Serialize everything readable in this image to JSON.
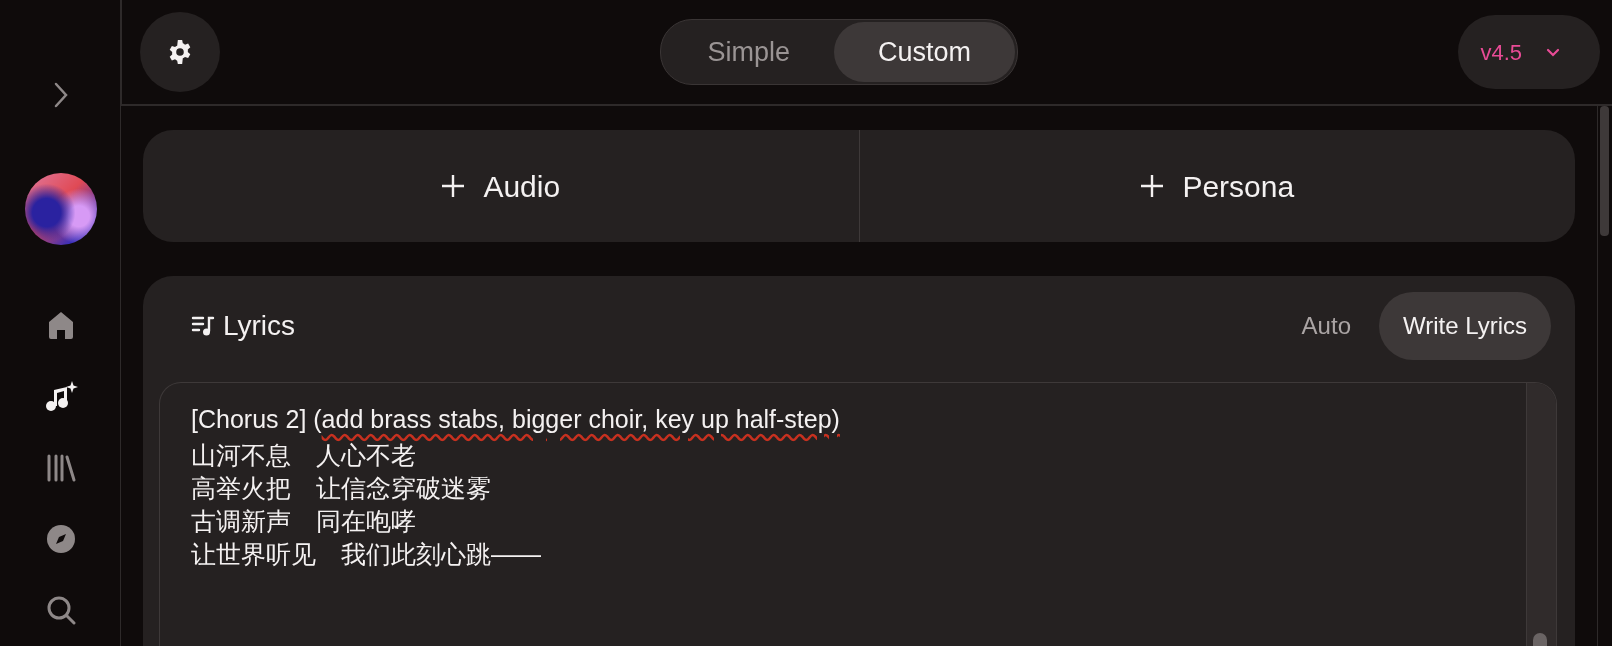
{
  "sidebar": {
    "items": [
      {
        "kind": "expand",
        "selected": false
      },
      {
        "kind": "avatar",
        "selected": false
      },
      {
        "kind": "home",
        "selected": false
      },
      {
        "kind": "create",
        "selected": true
      },
      {
        "kind": "library",
        "selected": false
      },
      {
        "kind": "explore",
        "selected": false
      },
      {
        "kind": "search",
        "selected": false
      }
    ]
  },
  "mode_tabs": [
    {
      "label": "Simple",
      "selected": false
    },
    {
      "label": "Custom",
      "selected": true
    }
  ],
  "model_select": {
    "value": "v4.5"
  },
  "add_buttons": [
    {
      "label": "Audio"
    },
    {
      "label": "Persona"
    }
  ],
  "lyrics": {
    "title": "Lyrics",
    "tabs": [
      {
        "label": "Auto",
        "selected": false
      },
      {
        "label": "Write Lyrics",
        "selected": true
      }
    ],
    "lines": [
      {
        "segments": [
          {
            "text": "[Chorus 2] (",
            "flagged": false
          },
          {
            "text": "add brass stabs, bigger choir, key up half-step)",
            "flagged": true
          }
        ]
      },
      {
        "segments": [
          {
            "text": "山河不息　人心不老",
            "flagged": false
          }
        ]
      },
      {
        "segments": [
          {
            "text": "高举火把　让信念穿破迷雾",
            "flagged": false
          }
        ]
      },
      {
        "segments": [
          {
            "text": "古调新声　同在咆哮",
            "flagged": false
          }
        ]
      },
      {
        "segments": [
          {
            "text": "让世界听见　我们此刻心跳——",
            "flagged": false
          }
        ]
      }
    ]
  }
}
